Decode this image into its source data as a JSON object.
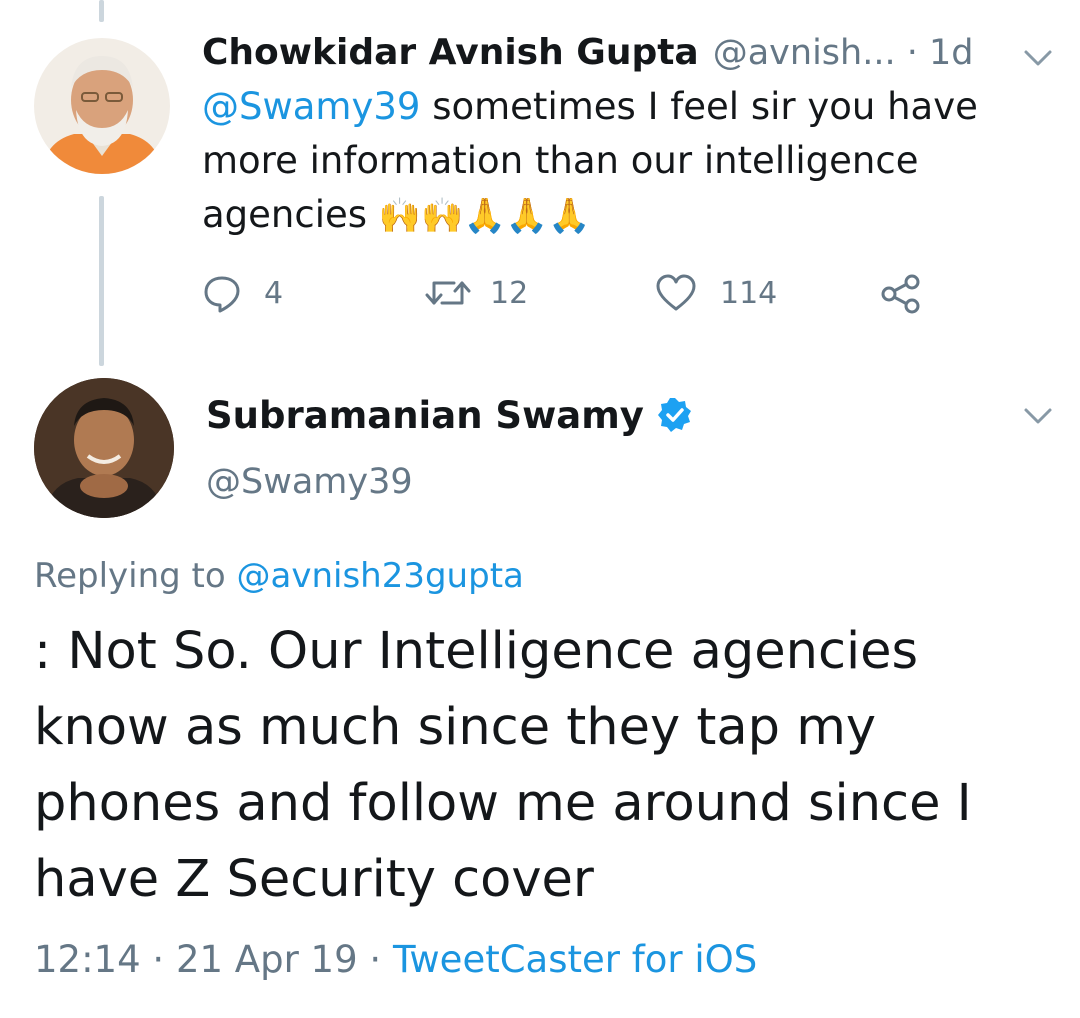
{
  "reply_tweet": {
    "display_name": "Chowkidar Avnish Gupta",
    "handle": "@avnish...",
    "separator": " · ",
    "time_ago": "1d",
    "mention": "@Swamy39",
    "text_line1": " sometimes I feel sir you have",
    "text_line2": "more information than our intelligence",
    "text_line3": "agencies ",
    "emoji": "🙌🙌🙏🙏🙏",
    "actions": {
      "replies": "4",
      "retweets": "12",
      "likes": "114"
    }
  },
  "main_tweet": {
    "display_name": "Subramanian Swamy",
    "handle": "@Swamy39",
    "verified": true,
    "replying_prefix": "Replying to ",
    "replying_to": "@avnish23gupta",
    "text_line1": ": Not So. Our Intelligence agencies",
    "text_line2": "know as much since they tap my",
    "text_line3": "phones and follow me around since I",
    "text_line4": "have Z Security cover",
    "time": "12:14",
    "sep1": " · ",
    "date": "21 Apr 19",
    "sep2": " · ",
    "source": "TweetCaster for iOS"
  },
  "colors": {
    "text": "#14171a",
    "muted": "#657786",
    "link": "#1b95e0",
    "thread_line": "#ccd6dd",
    "verified": "#1da1f2",
    "avatar1_bg": "#f2ede6",
    "saffron": "#f08a3a"
  },
  "icons": [
    "reply-icon",
    "retweet-icon",
    "like-icon",
    "share-icon",
    "chevron-down-icon",
    "verified-badge-icon"
  ]
}
